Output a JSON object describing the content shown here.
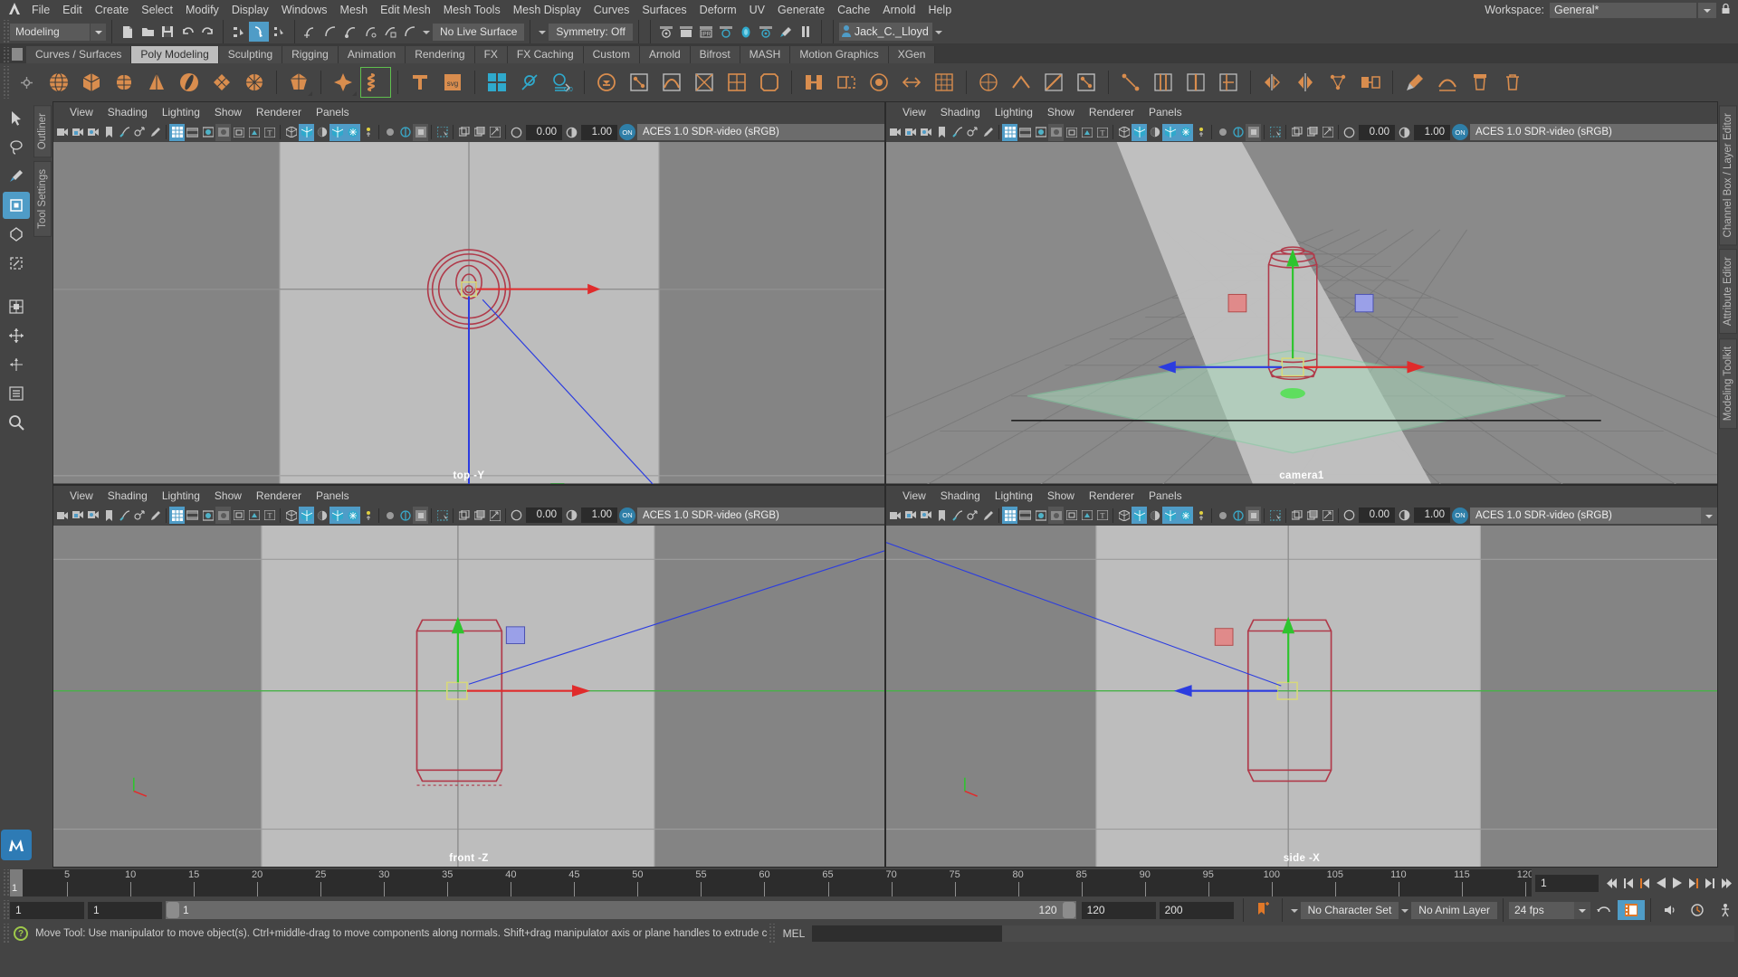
{
  "app": {
    "title": "Autodesk Maya",
    "logo_icon": "maya-logo-icon"
  },
  "menubar": {
    "items": [
      "File",
      "Edit",
      "Create",
      "Select",
      "Modify",
      "Display",
      "Windows",
      "Mesh",
      "Edit Mesh",
      "Mesh Tools",
      "Mesh Display",
      "Curves",
      "Surfaces",
      "Deform",
      "UV",
      "Generate",
      "Cache",
      "Arnold",
      "Help"
    ],
    "workspace_label": "Workspace:",
    "workspace_value": "General*",
    "lock_icon": "lock-icon"
  },
  "statusline": {
    "mode": "Modeling",
    "live_surface": "No Live Surface",
    "symmetry": "Symmetry: Off",
    "user": "Jack_C._Lloyd",
    "user_icon": "user-avatar-icon",
    "icons": {
      "new": "new-scene-icon",
      "open": "open-scene-icon",
      "save": "save-scene-icon",
      "undo": "undo-icon",
      "redo": "redo-icon",
      "select_by_hierarchy": "select-by-hierarchy-icon",
      "select_by_object": "select-by-object-type-icon",
      "select_by_component": "select-by-component-type-icon",
      "snap_grid": "snap-to-grid-icon",
      "snap_curve": "snap-to-curve-icon",
      "snap_point": "snap-to-point-icon",
      "snap_projected": "snap-to-projected-center-icon",
      "snap_view_plane": "snap-to-view-planes-icon",
      "snap_make_live": "make-live-icon",
      "render_current": "render-current-frame-icon",
      "render_settings": "render-settings-icon",
      "ipr": "ipr-render-icon",
      "render_sequence": "render-sequence-icon",
      "hypershade": "hypershade-icon",
      "render_view": "render-view-icon",
      "toggle_paint": "toggle-paint-effects-icon",
      "pause": "pause-icon"
    }
  },
  "shelf": {
    "tabs": [
      "Curves / Surfaces",
      "Poly Modeling",
      "Sculpting",
      "Rigging",
      "Animation",
      "Rendering",
      "FX",
      "FX Caching",
      "Custom",
      "Arnold",
      "Bifrost",
      "MASH",
      "Motion Graphics",
      "XGen"
    ],
    "active_tab": "Poly Modeling",
    "buttons": [
      "poly-sphere-icon",
      "poly-cube-icon",
      "poly-cylinder-icon",
      "poly-cone-icon",
      "poly-torus-icon",
      "poly-plane-icon",
      "poly-disc-icon",
      "poly-platonic-icon",
      "poly-super-ellipse-icon",
      "poly-helix-icon",
      "poly-type-icon",
      "poly-svg-icon",
      "poly-combine-icon",
      "poly-separate-icon",
      "poly-boolean-icon",
      "poly-extract-icon",
      "poly-merge-icon",
      "poly-smooth-icon",
      "poly-triangulate-icon",
      "poly-quadrangulate-icon",
      "poly-bevel-icon",
      "poly-bridge-icon",
      "poly-append-icon",
      "poly-fill-hole-icon",
      "poly-reduce-icon",
      "poly-remesh-icon",
      "poly-retopo-icon",
      "poly-crease-icon",
      "poly-multicut-icon",
      "poly-target-weld-icon",
      "poly-connect-icon",
      "poly-offset-edge-icon",
      "poly-insert-edge-loop-icon",
      "poly-slide-edge-icon",
      "poly-mirror-icon",
      "poly-symmetrize-icon",
      "poly-average-vertices-icon",
      "poly-transfer-attributes-icon",
      "poly-sculpt-icon",
      "poly-soften-edge-icon",
      "poly-cleanup-icon",
      "poly-delete-icon"
    ]
  },
  "left_toolbox": {
    "items": [
      {
        "name": "select-tool",
        "icon": "arrow-cursor-icon",
        "active": false
      },
      {
        "name": "lasso-tool",
        "icon": "lasso-icon",
        "active": false
      },
      {
        "name": "paint-select-tool",
        "icon": "paint-brush-icon",
        "active": false
      },
      {
        "name": "move-tool",
        "icon": "move-arrows-icon",
        "active": true
      },
      {
        "name": "rotate-tool",
        "icon": "rotate-circle-icon",
        "active": false
      },
      {
        "name": "scale-tool",
        "icon": "scale-box-icon",
        "active": false
      },
      {
        "name": "last-tool-used",
        "icon": "last-tool-icon",
        "active": false
      },
      {
        "name": "snap-translate",
        "icon": "snap-translate-icon",
        "active": false
      },
      {
        "name": "snap-move",
        "icon": "snap-move-icon",
        "active": false
      },
      {
        "name": "outliner-panel",
        "icon": "outliner-list-icon",
        "active": false
      },
      {
        "name": "magnify-view",
        "icon": "magnifier-icon",
        "active": false
      }
    ]
  },
  "left_vtabs": [
    "Outliner",
    "Tool Settings"
  ],
  "right_vtabs": [
    "Channel Box / Layer Editor",
    "Attribute Editor",
    "Modeling Toolkit"
  ],
  "viewport_menu": [
    "View",
    "Shading",
    "Lighting",
    "Show",
    "Renderer",
    "Panels"
  ],
  "viewport_toolbar": {
    "exposure": "0.00",
    "gamma": "1.00",
    "color_space": "ACES 1.0 SDR-video (sRGB)",
    "on_badge": "ON",
    "icons": [
      "select-camera-icon",
      "lock-camera-icon",
      "camera-attributes-icon",
      "bookmark-icon",
      "image-plane-icon",
      "2d-pan-zoom-icon",
      "grease-pencil-icon",
      "grid-toggle-icon",
      "film-gate-icon",
      "resolution-gate-icon",
      "gate-mask-icon",
      "field-chart-icon",
      "safe-action-icon",
      "safe-title-icon",
      "wireframe-icon",
      "smooth-shade-icon",
      "shaded-textured-icon",
      "use-all-lights-icon",
      "shadows-icon",
      "screen-space-ao-icon",
      "motion-blur-icon",
      "multisample-icon",
      "depth-of-field-icon",
      "isolate-select-icon",
      "xray-icon",
      "xray-joints-icon",
      "xray-active-components-icon",
      "exposure-icon",
      "gamma-icon"
    ]
  },
  "viewports": [
    {
      "name": "top-view",
      "label": "top -Y",
      "camera": "top"
    },
    {
      "name": "persp-view",
      "label": "camera1",
      "camera": "camera1"
    },
    {
      "name": "front-view",
      "label": "front -Z",
      "camera": "front"
    },
    {
      "name": "side-view",
      "label": "side -X",
      "camera": "side"
    }
  ],
  "timeslider": {
    "start": 1,
    "end": 120,
    "current": 1,
    "tick_step": 5,
    "labels": [
      5,
      10,
      15,
      20,
      25,
      30,
      35,
      40,
      45,
      50,
      55,
      60,
      65,
      70,
      75,
      80,
      85,
      90,
      95,
      100,
      105,
      110,
      115,
      120
    ],
    "current_field": "1",
    "playback_buttons": [
      "go-to-start-icon",
      "step-back-keyframe-icon",
      "step-back-frame-icon",
      "play-backwards-icon",
      "play-forwards-icon",
      "step-forward-frame-icon",
      "step-forward-keyframe-icon",
      "go-to-end-icon"
    ]
  },
  "rangeslider": {
    "anim_start": "1",
    "range_start": "1",
    "bar_start_label": "1",
    "bar_end_label": "120",
    "range_end": "120",
    "anim_end": "200",
    "auto_key_icon": "auto-keyframe-icon",
    "character_set": "No Character Set",
    "anim_layer": "No Anim Layer",
    "fps": "24 fps",
    "right_icons": [
      "loop-playback-icon",
      "animation-preferences-icon",
      "sound-icon",
      "anim-snapshot-icon",
      "character-icon"
    ]
  },
  "helpline": {
    "help_icon": "help-icon",
    "text": "Move Tool: Use manipulator to move object(s). Ctrl+middle-drag to move components along normals. Shift+drag manipulator axis or plane handles to extrude components or",
    "mel_label": "MEL",
    "command_value": ""
  },
  "colors": {
    "accent_blue": "#4f9cc7",
    "shelf_orange": "#d98d4e",
    "mesh_red": "#b03a4a",
    "axis_x": "#e03030",
    "axis_y": "#2ec42e",
    "axis_z": "#3050e0",
    "viewport_bg": "#bdbdbd",
    "panel_bg": "#444444",
    "help_green": "#9ec84a"
  }
}
